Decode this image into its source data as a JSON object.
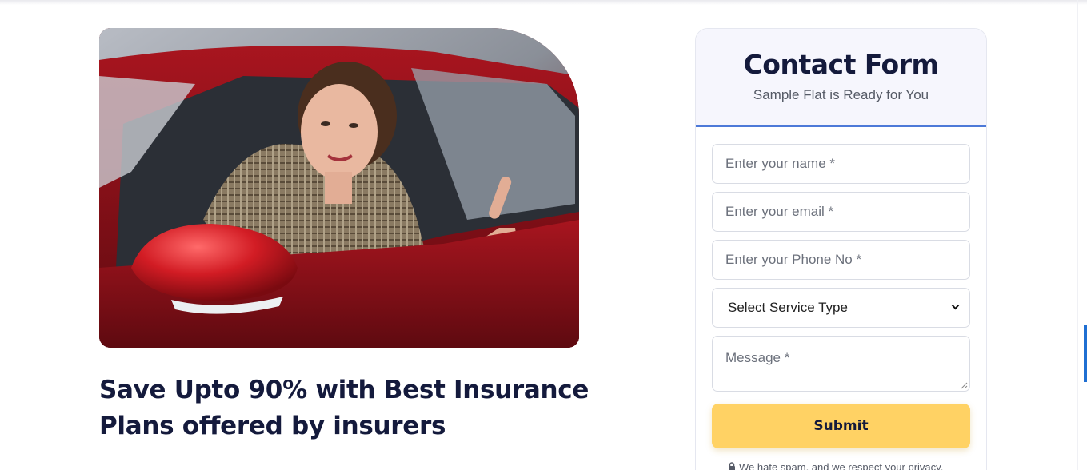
{
  "hero": {
    "image_alt": "woman-in-red-car-thumbs-up",
    "headline": "Save Upto 90% with Best Insurance Plans offered by insurers"
  },
  "contact_form": {
    "title": "Contact Form",
    "subtitle": "Sample Flat is Ready for You",
    "name_placeholder": "Enter your name *",
    "email_placeholder": "Enter your email *",
    "phone_placeholder": "Enter your Phone No *",
    "service_select": "Select Service Type",
    "message_placeholder": "Message *",
    "submit_label": "Submit",
    "privacy_note": "We hate spam, and we respect your privacy."
  },
  "colors": {
    "headline": "#141a3c",
    "accent_border": "#4d79d8",
    "submit_bg": "#ffd264",
    "header_bg": "#f6f6fd"
  },
  "icons": [
    "chevron-down-icon",
    "lock-icon",
    "resize-grip-icon"
  ]
}
